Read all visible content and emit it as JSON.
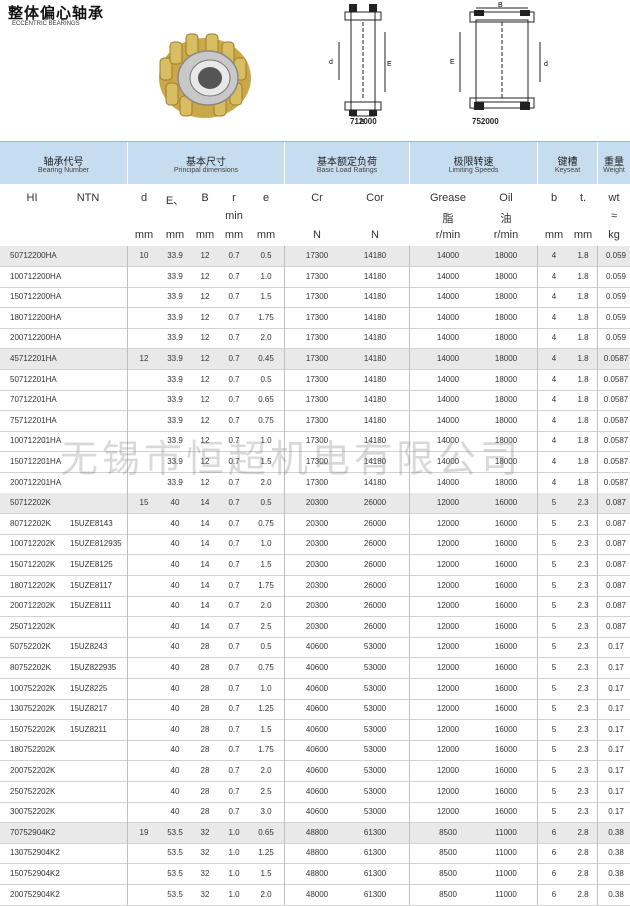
{
  "header": {
    "title": "整体偏心轴承",
    "subtitle": "ECCENTRIC BEARINGS",
    "drawing1_caption": "712000",
    "drawing2_caption": "752000"
  },
  "columns": {
    "bearing_cn": "轴承代号",
    "bearing_en": "Bearing Number",
    "dims_cn": "基本尺寸",
    "dims_en": "Principal dimensions",
    "load_cn": "基本额定负荷",
    "load_en": "Basic Load Ratings",
    "speed_cn": "极限转速",
    "speed_en": "Limiting Speeds",
    "key_cn": "键槽",
    "key_en": "Keyseat",
    "weight_cn": "重量",
    "weight_en": "Weight"
  },
  "subheaders": {
    "hl": "HI",
    "ntn": "NTN",
    "d": "d",
    "e_big": "E、",
    "b": "B",
    "r": "r",
    "r_sub": "min",
    "e": "e",
    "cr": "Cr",
    "cor": "Cor",
    "grease": "Grease",
    "grease_cn": "脂",
    "oil": "Oil",
    "oil_cn": "油",
    "kb": "b",
    "kt": "t.",
    "wt": "wt",
    "wt_sub": "≈",
    "mm": "mm",
    "n": "N",
    "rmin": "r/min",
    "kg": "kg"
  },
  "watermark": "无锡市恒超机电有限公司",
  "rows": [
    {
      "hl": "50712200HA",
      "ntn": "",
      "d": "10",
      "E": "33.9",
      "B": "12",
      "r": "0.7",
      "e": "0.5",
      "cr": "17300",
      "cor": "14180",
      "grease": "14000",
      "oil": "18000",
      "b": "4",
      "t": "1.8",
      "wt": "0.059",
      "shade": true
    },
    {
      "hl": "100712200HA",
      "ntn": "",
      "d": "",
      "E": "33.9",
      "B": "12",
      "r": "0.7",
      "e": "1.0",
      "cr": "17300",
      "cor": "14180",
      "grease": "14000",
      "oil": "18000",
      "b": "4",
      "t": "1.8",
      "wt": "0.059",
      "shade": false
    },
    {
      "hl": "150712200HA",
      "ntn": "",
      "d": "",
      "E": "33.9",
      "B": "12",
      "r": "0.7",
      "e": "1.5",
      "cr": "17300",
      "cor": "14180",
      "grease": "14000",
      "oil": "18000",
      "b": "4",
      "t": "1.8",
      "wt": "0.059",
      "shade": false
    },
    {
      "hl": "180712200HA",
      "ntn": "",
      "d": "",
      "E": "33.9",
      "B": "12",
      "r": "0.7",
      "e": "1.75",
      "cr": "17300",
      "cor": "14180",
      "grease": "14000",
      "oil": "18000",
      "b": "4",
      "t": "1.8",
      "wt": "0.059",
      "shade": false
    },
    {
      "hl": "200712200HA",
      "ntn": "",
      "d": "",
      "E": "33.9",
      "B": "12",
      "r": "0.7",
      "e": "2.0",
      "cr": "17300",
      "cor": "14180",
      "grease": "14000",
      "oil": "18000",
      "b": "4",
      "t": "1.8",
      "wt": "0.059",
      "shade": false
    },
    {
      "hl": "45712201HA",
      "ntn": "",
      "d": "12",
      "E": "33.9",
      "B": "12",
      "r": "0.7",
      "e": "0.45",
      "cr": "17300",
      "cor": "14180",
      "grease": "14000",
      "oil": "18000",
      "b": "4",
      "t": "1.8",
      "wt": "0.0587",
      "shade": true
    },
    {
      "hl": "50712201HA",
      "ntn": "",
      "d": "",
      "E": "33.9",
      "B": "12",
      "r": "0.7",
      "e": "0.5",
      "cr": "17300",
      "cor": "14180",
      "grease": "14000",
      "oil": "18000",
      "b": "4",
      "t": "1.8",
      "wt": "0.0587",
      "shade": false
    },
    {
      "hl": "70712201HA",
      "ntn": "",
      "d": "",
      "E": "33.9",
      "B": "12",
      "r": "0.7",
      "e": "0.65",
      "cr": "17300",
      "cor": "14180",
      "grease": "14000",
      "oil": "18000",
      "b": "4",
      "t": "1.8",
      "wt": "0.0587",
      "shade": false
    },
    {
      "hl": "75712201HA",
      "ntn": "",
      "d": "",
      "E": "33.9",
      "B": "12",
      "r": "0.7",
      "e": "0.75",
      "cr": "17300",
      "cor": "14180",
      "grease": "14000",
      "oil": "18000",
      "b": "4",
      "t": "1.8",
      "wt": "0.0587",
      "shade": false
    },
    {
      "hl": "100712201HA",
      "ntn": "",
      "d": "",
      "E": "33.9",
      "B": "12",
      "r": "0.7",
      "e": "1.0",
      "cr": "17300",
      "cor": "14180",
      "grease": "14000",
      "oil": "18000",
      "b": "4",
      "t": "1.8",
      "wt": "0.0587",
      "shade": false
    },
    {
      "hl": "150712201HA",
      "ntn": "",
      "d": "",
      "E": "33.9",
      "B": "12",
      "r": "0.7",
      "e": "1.5",
      "cr": "17300",
      "cor": "14180",
      "grease": "14000",
      "oil": "18000",
      "b": "4",
      "t": "1.8",
      "wt": "0.0587",
      "shade": false
    },
    {
      "hl": "200712201HA",
      "ntn": "",
      "d": "",
      "E": "33.9",
      "B": "12",
      "r": "0.7",
      "e": "2.0",
      "cr": "17300",
      "cor": "14180",
      "grease": "14000",
      "oil": "18000",
      "b": "4",
      "t": "1.8",
      "wt": "0.0587",
      "shade": false
    },
    {
      "hl": "50712202K",
      "ntn": "",
      "d": "15",
      "E": "40",
      "B": "14",
      "r": "0.7",
      "e": "0.5",
      "cr": "20300",
      "cor": "26000",
      "grease": "12000",
      "oil": "16000",
      "b": "5",
      "t": "2.3",
      "wt": "0.087",
      "shade": true
    },
    {
      "hl": "80712202K",
      "ntn": "15UZE8143",
      "d": "",
      "E": "40",
      "B": "14",
      "r": "0.7",
      "e": "0.75",
      "cr": "20300",
      "cor": "26000",
      "grease": "12000",
      "oil": "16000",
      "b": "5",
      "t": "2.3",
      "wt": "0.087",
      "shade": false
    },
    {
      "hl": "100712202K",
      "ntn": "15UZE812935",
      "d": "",
      "E": "40",
      "B": "14",
      "r": "0.7",
      "e": "1.0",
      "cr": "20300",
      "cor": "26000",
      "grease": "12000",
      "oil": "16000",
      "b": "5",
      "t": "2.3",
      "wt": "0.087",
      "shade": false
    },
    {
      "hl": "150712202K",
      "ntn": "15UZE8125",
      "d": "",
      "E": "40",
      "B": "14",
      "r": "0.7",
      "e": "1.5",
      "cr": "20300",
      "cor": "26000",
      "grease": "12000",
      "oil": "16000",
      "b": "5",
      "t": "2.3",
      "wt": "0.087",
      "shade": false
    },
    {
      "hl": "180712202K",
      "ntn": "15UZE8117",
      "d": "",
      "E": "40",
      "B": "14",
      "r": "0.7",
      "e": "1.75",
      "cr": "20300",
      "cor": "26000",
      "grease": "12000",
      "oil": "16000",
      "b": "5",
      "t": "2.3",
      "wt": "0.087",
      "shade": false
    },
    {
      "hl": "200712202K",
      "ntn": "15UZE8111",
      "d": "",
      "E": "40",
      "B": "14",
      "r": "0.7",
      "e": "2.0",
      "cr": "20300",
      "cor": "26000",
      "grease": "12000",
      "oil": "16000",
      "b": "5",
      "t": "2.3",
      "wt": "0.087",
      "shade": false
    },
    {
      "hl": "250712202K",
      "ntn": "",
      "d": "",
      "E": "40",
      "B": "14",
      "r": "0.7",
      "e": "2.5",
      "cr": "20300",
      "cor": "26000",
      "grease": "12000",
      "oil": "16000",
      "b": "5",
      "t": "2.3",
      "wt": "0.087",
      "shade": false
    },
    {
      "hl": "50752202K",
      "ntn": "15UZ8243",
      "d": "",
      "E": "40",
      "B": "28",
      "r": "0.7",
      "e": "0.5",
      "cr": "40600",
      "cor": "53000",
      "grease": "12000",
      "oil": "16000",
      "b": "5",
      "t": "2.3",
      "wt": "0.17",
      "shade": false
    },
    {
      "hl": "80752202K",
      "ntn": "15UZ822935",
      "d": "",
      "E": "40",
      "B": "28",
      "r": "0.7",
      "e": "0.75",
      "cr": "40600",
      "cor": "53000",
      "grease": "12000",
      "oil": "16000",
      "b": "5",
      "t": "2.3",
      "wt": "0.17",
      "shade": false
    },
    {
      "hl": "100752202K",
      "ntn": "15UZ8225",
      "d": "",
      "E": "40",
      "B": "28",
      "r": "0.7",
      "e": "1.0",
      "cr": "40600",
      "cor": "53000",
      "grease": "12000",
      "oil": "16000",
      "b": "5",
      "t": "2.3",
      "wt": "0.17",
      "shade": false
    },
    {
      "hl": "130752202K",
      "ntn": "15UZ8217",
      "d": "",
      "E": "40",
      "B": "28",
      "r": "0.7",
      "e": "1.25",
      "cr": "40600",
      "cor": "53000",
      "grease": "12000",
      "oil": "16000",
      "b": "5",
      "t": "2.3",
      "wt": "0.17",
      "shade": false
    },
    {
      "hl": "150752202K",
      "ntn": "15UZ8211",
      "d": "",
      "E": "40",
      "B": "28",
      "r": "0.7",
      "e": "1.5",
      "cr": "40600",
      "cor": "53000",
      "grease": "12000",
      "oil": "16000",
      "b": "5",
      "t": "2.3",
      "wt": "0.17",
      "shade": false
    },
    {
      "hl": "180752202K",
      "ntn": "",
      "d": "",
      "E": "40",
      "B": "28",
      "r": "0.7",
      "e": "1.75",
      "cr": "40600",
      "cor": "53000",
      "grease": "12000",
      "oil": "16000",
      "b": "5",
      "t": "2.3",
      "wt": "0.17",
      "shade": false
    },
    {
      "hl": "200752202K",
      "ntn": "",
      "d": "",
      "E": "40",
      "B": "28",
      "r": "0.7",
      "e": "2.0",
      "cr": "40600",
      "cor": "53000",
      "grease": "12000",
      "oil": "16000",
      "b": "5",
      "t": "2.3",
      "wt": "0.17",
      "shade": false
    },
    {
      "hl": "250752202K",
      "ntn": "",
      "d": "",
      "E": "40",
      "B": "28",
      "r": "0.7",
      "e": "2.5",
      "cr": "40600",
      "cor": "53000",
      "grease": "12000",
      "oil": "16000",
      "b": "5",
      "t": "2.3",
      "wt": "0.17",
      "shade": false
    },
    {
      "hl": "300752202K",
      "ntn": "",
      "d": "",
      "E": "40",
      "B": "28",
      "r": "0.7",
      "e": "3.0",
      "cr": "40600",
      "cor": "53000",
      "grease": "12000",
      "oil": "16000",
      "b": "5",
      "t": "2.3",
      "wt": "0.17",
      "shade": false
    },
    {
      "hl": "70752904K2",
      "ntn": "",
      "d": "19",
      "E": "53.5",
      "B": "32",
      "r": "1.0",
      "e": "0.65",
      "cr": "48800",
      "cor": "61300",
      "grease": "8500",
      "oil": "11000",
      "b": "6",
      "t": "2.8",
      "wt": "0.38",
      "shade": true
    },
    {
      "hl": "130752904K2",
      "ntn": "",
      "d": "",
      "E": "53.5",
      "B": "32",
      "r": "1.0",
      "e": "1.25",
      "cr": "48800",
      "cor": "61300",
      "grease": "8500",
      "oil": "11000",
      "b": "6",
      "t": "2.8",
      "wt": "0.38",
      "shade": false
    },
    {
      "hl": "150752904K2",
      "ntn": "",
      "d": "",
      "E": "53.5",
      "B": "32",
      "r": "1.0",
      "e": "1.5",
      "cr": "48800",
      "cor": "61300",
      "grease": "8500",
      "oil": "11000",
      "b": "6",
      "t": "2.8",
      "wt": "0.38",
      "shade": false
    },
    {
      "hl": "200752904K2",
      "ntn": "",
      "d": "",
      "E": "53.5",
      "B": "32",
      "r": "1.0",
      "e": "2.0",
      "cr": "48000",
      "cor": "61300",
      "grease": "8500",
      "oil": "11000",
      "b": "6",
      "t": "2.8",
      "wt": "0.38",
      "shade": false
    }
  ]
}
